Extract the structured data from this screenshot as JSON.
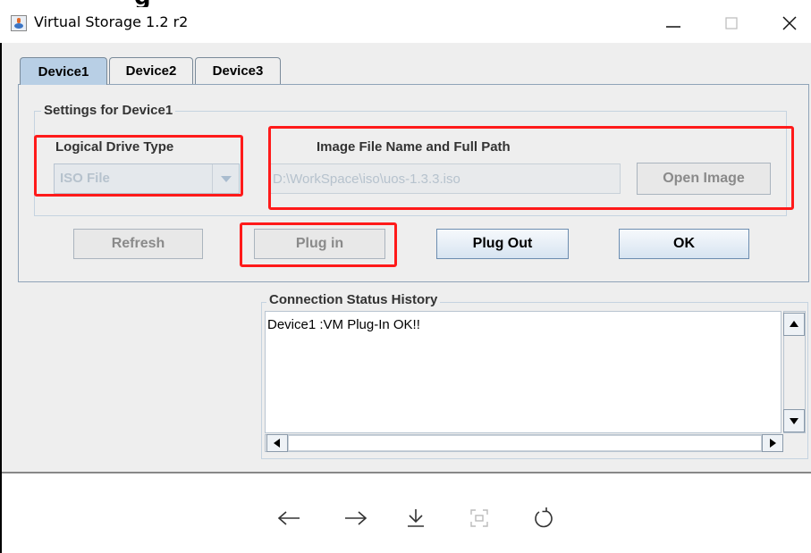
{
  "window": {
    "title": "Virtual Storage 1.2 r2",
    "partial_heading": "g"
  },
  "tabs": [
    {
      "label": "Device1",
      "selected": true
    },
    {
      "label": "Device2",
      "selected": false
    },
    {
      "label": "Device3",
      "selected": false
    }
  ],
  "settings": {
    "group_title": "Settings for Device1",
    "logical_drive_type_label": "Logical Drive Type",
    "logical_drive_type_value": "ISO File",
    "image_path_label": "Image File Name and Full Path",
    "image_path_value": "D:\\WorkSpace\\iso\\uos-1.3.3.iso",
    "open_image_label": "Open Image"
  },
  "actions": {
    "refresh": "Refresh",
    "plug_in": "Plug in",
    "plug_out": "Plug Out",
    "ok": "OK"
  },
  "status": {
    "group_title": "Connection Status History",
    "lines": [
      "Device1 :VM Plug-In OK!!"
    ]
  },
  "toolbar": {
    "icons": [
      "arrow-left-icon",
      "arrow-right-icon",
      "download-icon",
      "fit-screen-icon",
      "rotate-icon"
    ]
  },
  "colors": {
    "annotation_red": "#ff1a1a",
    "selected_tab": "#b8cfe5",
    "background": "#eeeeee"
  }
}
